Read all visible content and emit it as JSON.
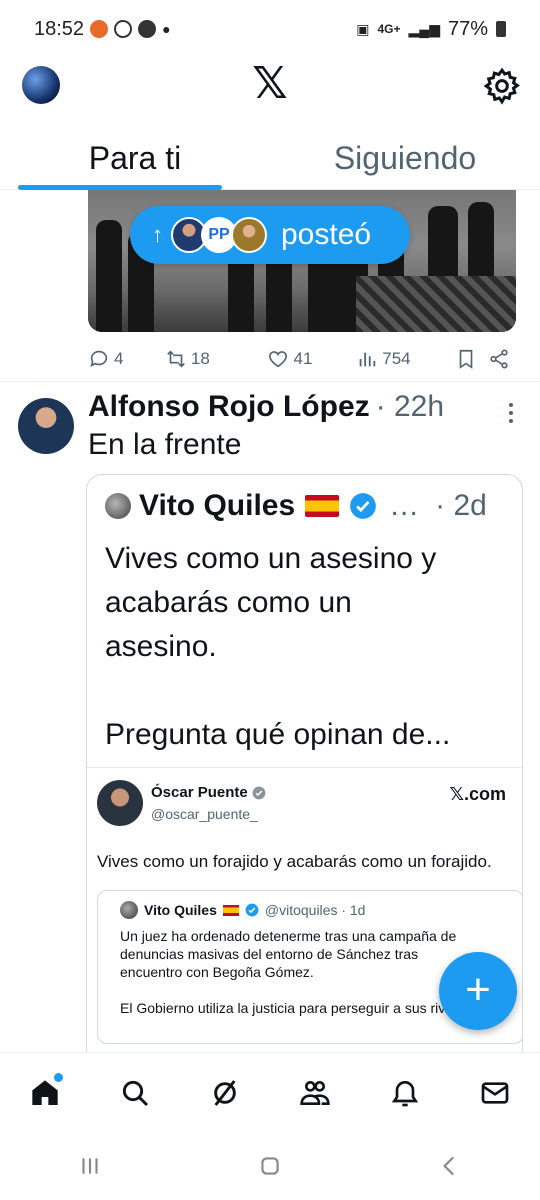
{
  "status": {
    "time": "18:52",
    "network": "4G+",
    "battery": "77%"
  },
  "header": {
    "logo": "𝕏"
  },
  "tabs": [
    {
      "label": "Para ti",
      "active": true
    },
    {
      "label": "Siguiendo",
      "active": false
    }
  ],
  "posted_pill": {
    "label": "posteó",
    "arrow": "↑"
  },
  "prev_actions": {
    "replies": "4",
    "reposts": "18",
    "likes": "41",
    "views": "754"
  },
  "post": {
    "author": "Alfonso Rojo López",
    "time": "· 22h",
    "text": "En la frente"
  },
  "quote": {
    "author": "Vito Quiles",
    "ellipsis": "…",
    "time": "· 2d",
    "lines": [
      "Vives como un asesino y",
      "acabarás como un",
      "asesino.",
      "",
      "Pregunta qué opinan de..."
    ]
  },
  "screenshot": {
    "name": "Óscar Puente",
    "handle": "@oscar_puente_",
    "site": "𝕏.com",
    "text": "Vives como un forajido y acabarás como un forajido.",
    "inner": {
      "name": "Vito Quiles",
      "handle": "@vitoquiles · 1d",
      "lines": [
        "Un juez ha ordenado detenerme tras una campaña de",
        "denuncias masivas del entorno de Sánchez tras",
        "encuentro con Begoña Gómez.",
        "",
        "El Gobierno utiliza la justicia para perseguir a sus rival..."
      ]
    }
  },
  "fab": {
    "label": "+"
  },
  "colors": {
    "accent": "#1d9bf0",
    "text": "#0f1419",
    "muted": "#536471"
  }
}
